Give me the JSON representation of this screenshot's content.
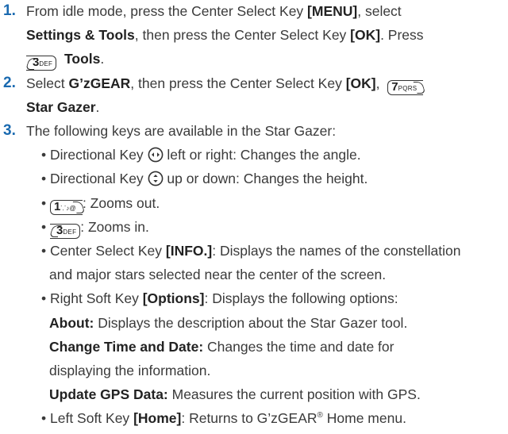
{
  "step1": {
    "number": "1.",
    "line1_pre": "From idle mode, press the Center Select Key ",
    "menu_label": "[MENU]",
    "line1_post": ", select",
    "settings_label": "Settings & Tools",
    "line2_mid": ", then press the Center Select Key ",
    "ok_label": "[OK]",
    "line2_post": ". Press",
    "key3_digit": "3",
    "key3_letters": "DEF",
    "tools_label": "Tools",
    "line3_post": "."
  },
  "step2": {
    "number": "2.",
    "pre": "Select ",
    "gzgear_label": "G’zGEAR",
    "mid": ", then press the Center Select Key ",
    "ok_label": "[OK]",
    "sep": ",",
    "key7_digit": "7",
    "key7_letters": "PQRS",
    "star_gazer_label": "Star Gazer",
    "post": "."
  },
  "step3": {
    "number": "3.",
    "intro": "The following keys are available in the Star Gazer:",
    "b1_pre": "• Directional Key ",
    "b1_post": " left or right: Changes the angle.",
    "b2_pre": "• Directional Key ",
    "b2_post": " up or down: Changes the height.",
    "b3_bullet": "•",
    "key1_digit": "1",
    "key1_letters": "⸪♪@",
    "b3_post": ": Zooms out.",
    "b4_bullet": "•",
    "b4_post": ": Zooms in.",
    "b5_pre": "• Center Select Key ",
    "info_label": "[INFO.]",
    "b5_post": ": Displays the names of the constellation",
    "b5_cont": "and major stars selected near the center of the screen.",
    "b6_pre": "• Right Soft Key ",
    "options_label": "[Options]",
    "b6_post": ": Displays the following options:",
    "about_label": "About:",
    "about_text": " Displays the description about the Star Gazer tool.",
    "change_label": "Change Time and Date:",
    "change_text": " Changes the time and date for",
    "change_cont": "displaying the information.",
    "update_label": "Update GPS Data:",
    "update_text": " Measures the current position with GPS.",
    "b7_pre": "• Left Soft Key ",
    "home_label": "[Home]",
    "b7_post": ": Returns to G’zGEAR",
    "reg_mark": "®",
    "b7_end": " Home menu."
  },
  "colors": {
    "step_number": "#1a6ab0",
    "body_text": "#3a3a3a",
    "bold_text": "#222222"
  },
  "icons": [
    "directional-key-left-right-icon",
    "directional-key-up-down-icon"
  ]
}
